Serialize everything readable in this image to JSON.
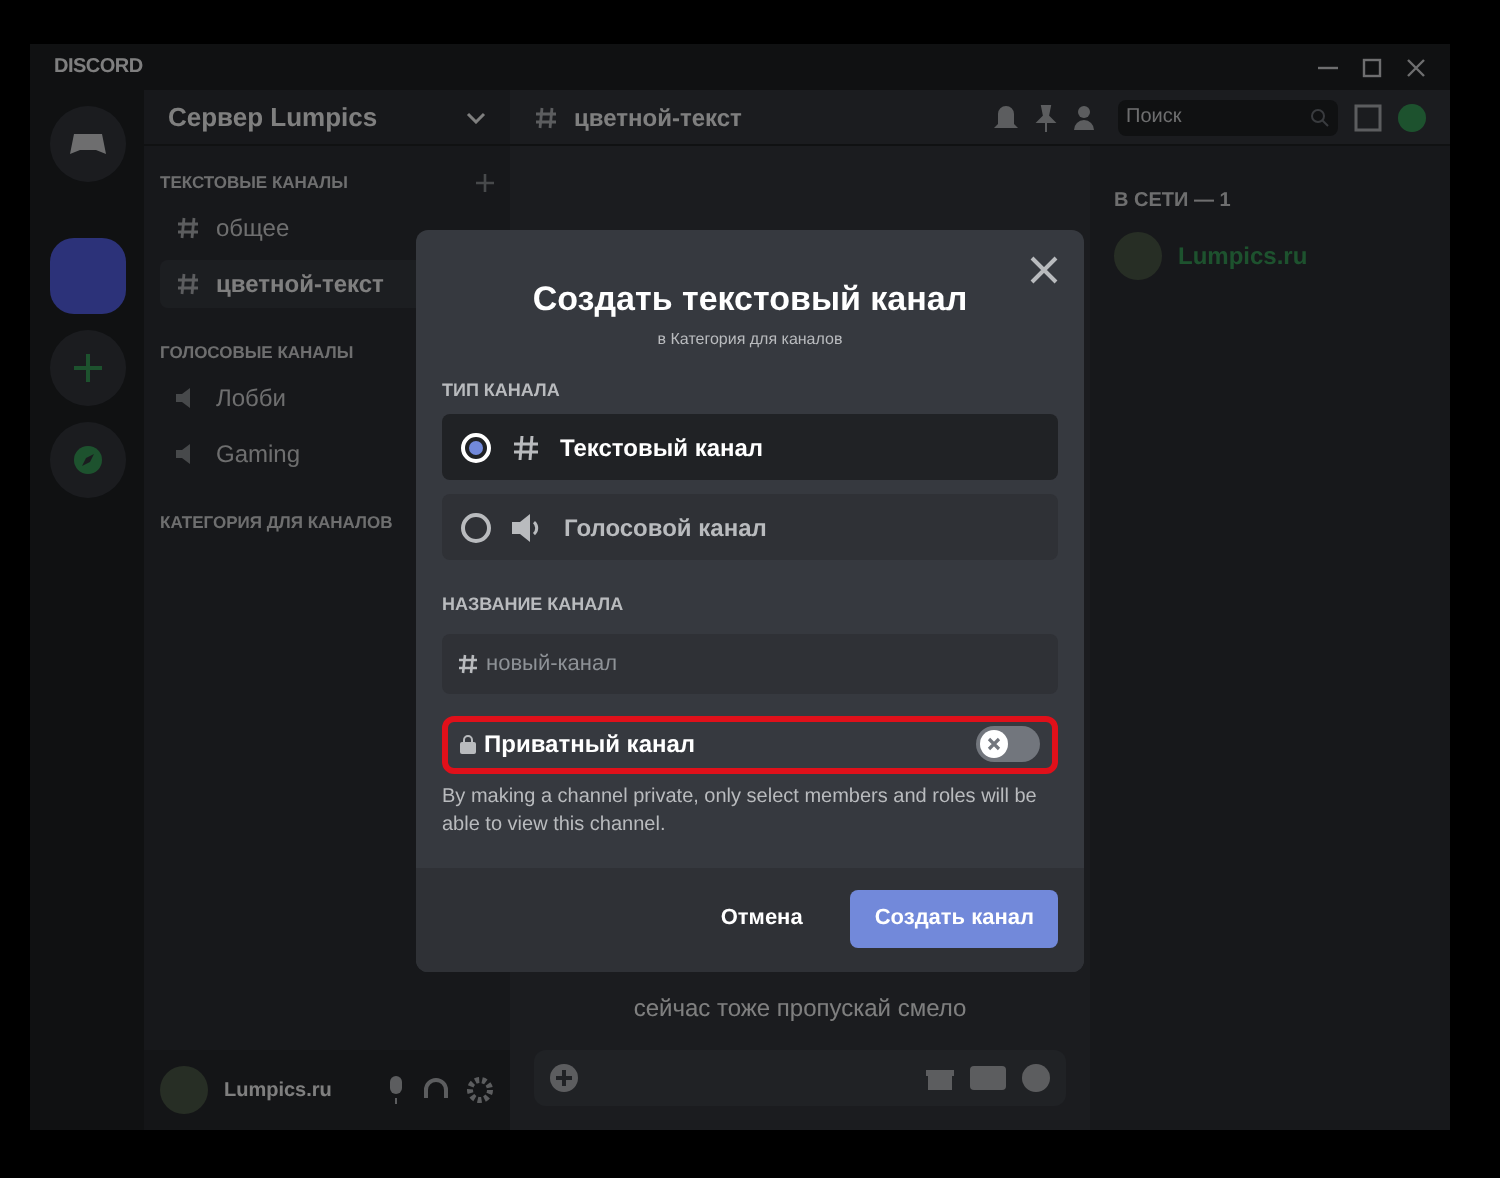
{
  "app": {
    "logo": "DISCORD"
  },
  "server": {
    "name": "Сервер Lumpics"
  },
  "categories": [
    {
      "name": "ТЕКСТОВЫЕ КАНАЛЫ",
      "channels": [
        {
          "name": "общее",
          "kind": "text",
          "selected": false
        },
        {
          "name": "цветной-текст",
          "kind": "text",
          "selected": true
        }
      ]
    },
    {
      "name": "ГОЛОСОВЫЕ КАНАЛЫ",
      "channels": [
        {
          "name": "Лобби",
          "kind": "voice",
          "selected": false
        },
        {
          "name": "Gaming",
          "kind": "voice",
          "selected": false
        }
      ]
    },
    {
      "name": "КАТЕГОРИЯ ДЛЯ КАНАЛОВ"
    }
  ],
  "user": {
    "name": "Lumpics.ru"
  },
  "chat": {
    "channel": "цветной-текст",
    "search_placeholder": "Поиск",
    "message": "сейчас тоже пропускай смело"
  },
  "members": {
    "heading": "В СЕТИ — 1",
    "items": [
      {
        "name": "Lumpics.ru"
      }
    ]
  },
  "modal": {
    "title": "Создать текстовый канал",
    "subtitle": "в Категория для каналов",
    "type_label": "ТИП КАНАЛА",
    "types": [
      {
        "kind": "text",
        "label": "Текстовый канал",
        "selected": true
      },
      {
        "kind": "voice",
        "label": "Голосовой канал",
        "selected": false
      }
    ],
    "name_label": "НАЗВАНИЕ КАНАЛА",
    "name_placeholder": "новый-канал",
    "private": {
      "label": "Приватный канал",
      "on": false,
      "highlighted": true
    },
    "note": "By making a channel private, only select members and roles will be able to view this channel.",
    "buttons": [
      {
        "kind": "secondary",
        "label": "Отмена"
      },
      {
        "kind": "primary",
        "label": "Создать канал"
      }
    ]
  }
}
